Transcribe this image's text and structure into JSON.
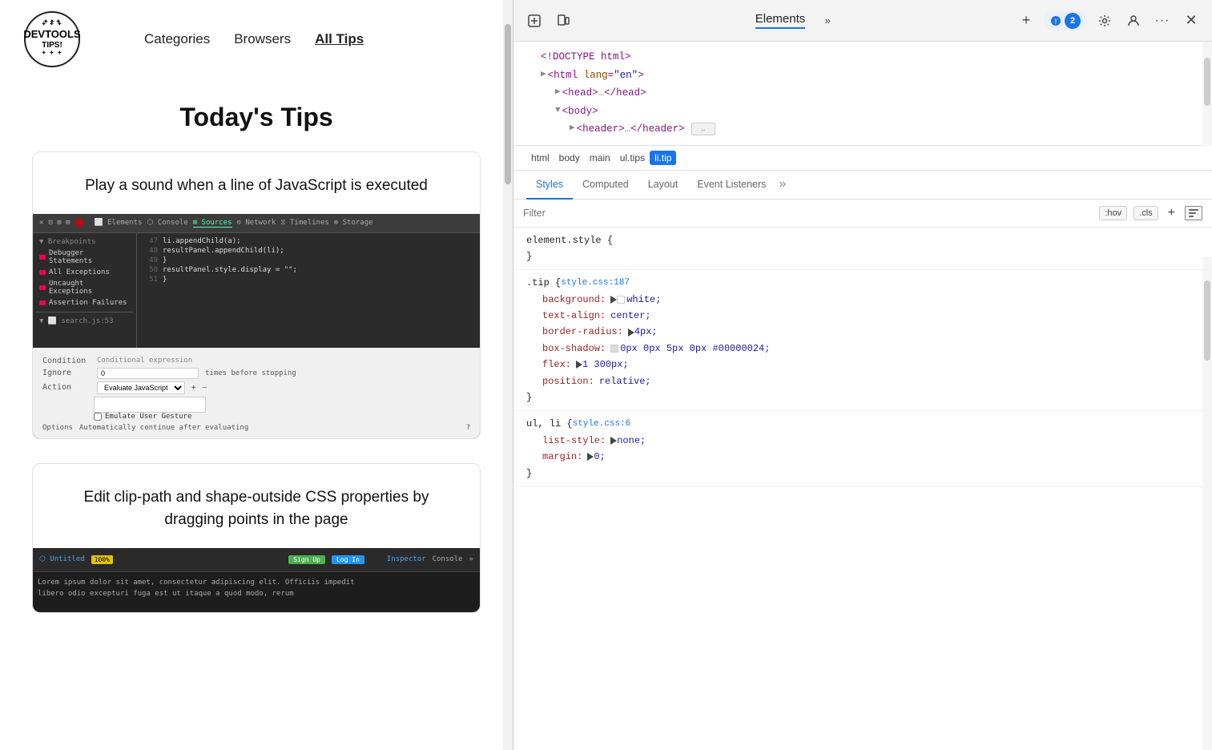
{
  "nav": {
    "logo_line1": "DEVTOOLS",
    "logo_line2": "TIPS!",
    "links": [
      {
        "label": "Categories",
        "active": false
      },
      {
        "label": "Browsers",
        "active": false
      },
      {
        "label": "All Tips",
        "active": true
      }
    ]
  },
  "page_title": "Today's Tips",
  "tip1": {
    "title": "Play a sound when a line of JavaScript is\nexecuted",
    "breakpoints": [
      "Debugger Statements",
      "All Exceptions",
      "Uncaught Exceptions",
      "Assertion Failures"
    ],
    "file": "search.js:53",
    "condition_label": "Condition",
    "condition_placeholder": "Conditional expression",
    "ignore_label": "Ignore",
    "ignore_value": "0",
    "times_label": "times before stopping",
    "action_label": "Action",
    "action_value": "Evaluate JavaScript",
    "emulate_label": "Emulate User Gesture",
    "options_label": "Options",
    "options_value": "Automatically continue after evaluating"
  },
  "tip2": {
    "title": "Edit clip-path and shape-outside CSS\nproperties by dragging points in the page",
    "inspector_tab": "Inspector",
    "console_tab": "Console"
  },
  "devtools": {
    "panel_title": "Elements",
    "badge_count": "2",
    "dom": {
      "doctype": "<!DOCTYPE html>",
      "html_open": "<html lang=\"en\">",
      "head": "<head>…</head>",
      "body_open": "<body>",
      "header": "<header>…</header>"
    },
    "breadcrumb": [
      "html",
      "body",
      "main",
      "ul.tips",
      "li.tip"
    ],
    "tabs": [
      "Styles",
      "Computed",
      "Layout",
      "Event Listeners"
    ],
    "filter_placeholder": "Filter",
    "filter_btns": [
      ":hov",
      ".cls"
    ],
    "rules": [
      {
        "selector": "element.style {",
        "close": "}",
        "props": []
      },
      {
        "selector": ".tip {",
        "source": "style.css:187",
        "close": "}",
        "props": [
          {
            "name": "background:",
            "value": "white;",
            "has_swatch": true,
            "swatch_color": "#fff",
            "has_triangle": true
          },
          {
            "name": "text-align:",
            "value": "center;"
          },
          {
            "name": "border-radius:",
            "value": "4px;",
            "has_triangle": true
          },
          {
            "name": "box-shadow:",
            "value": "0px 0px 5px 0px #00000024;",
            "has_swatch": true,
            "swatch_color": "rgba(0,0,0,0.14)",
            "has_triangle": true
          },
          {
            "name": "flex:",
            "value": "1 300px;",
            "has_triangle": true
          },
          {
            "name": "position:",
            "value": "relative;"
          }
        ]
      },
      {
        "selector": "ul, li {",
        "source": "style.css:6",
        "close": "}",
        "props": [
          {
            "name": "list-style:",
            "value": "none;",
            "has_triangle": true
          },
          {
            "name": "margin:",
            "value": "0;",
            "has_triangle": true
          }
        ]
      }
    ]
  }
}
